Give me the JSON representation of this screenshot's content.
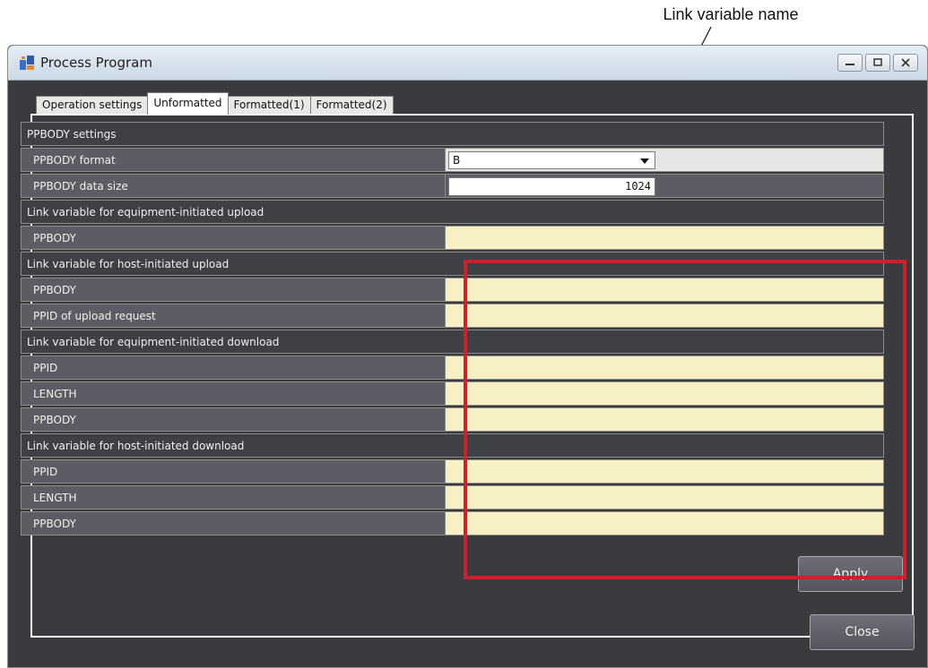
{
  "annotation": {
    "label": "Link variable name"
  },
  "window": {
    "title": "Process Program"
  },
  "tabs": [
    {
      "label": "Operation settings",
      "active": false
    },
    {
      "label": "Unformatted",
      "active": true
    },
    {
      "label": "Formatted(1)",
      "active": false
    },
    {
      "label": "Formatted(2)",
      "active": false
    }
  ],
  "grid": {
    "rows": [
      {
        "kind": "section",
        "label": "PPBODY settings"
      },
      {
        "kind": "select",
        "label": "PPBODY format",
        "value": "B"
      },
      {
        "kind": "input",
        "label": "PPBODY data size",
        "value": "1024"
      },
      {
        "kind": "section",
        "label": "Link variable for equipment-initiated upload"
      },
      {
        "kind": "link",
        "label": "PPBODY",
        "value": ""
      },
      {
        "kind": "section",
        "label": "Link variable for host-initiated upload"
      },
      {
        "kind": "link",
        "label": "PPBODY",
        "value": ""
      },
      {
        "kind": "link",
        "label": "PPID of upload request",
        "value": ""
      },
      {
        "kind": "section",
        "label": "Link variable for equipment-initiated download"
      },
      {
        "kind": "link",
        "label": "PPID",
        "value": ""
      },
      {
        "kind": "link",
        "label": "LENGTH",
        "value": ""
      },
      {
        "kind": "link",
        "label": "PPBODY",
        "value": ""
      },
      {
        "kind": "section",
        "label": "Link variable for host-initiated download"
      },
      {
        "kind": "link",
        "label": "PPID",
        "value": ""
      },
      {
        "kind": "link",
        "label": "LENGTH",
        "value": ""
      },
      {
        "kind": "link",
        "label": "PPBODY",
        "value": ""
      }
    ]
  },
  "buttons": {
    "apply": "Apply",
    "close": "Close"
  },
  "colors": {
    "highlight": "#c8232c",
    "link_field": "#f7f0c4",
    "background": "#3a3a3f"
  }
}
